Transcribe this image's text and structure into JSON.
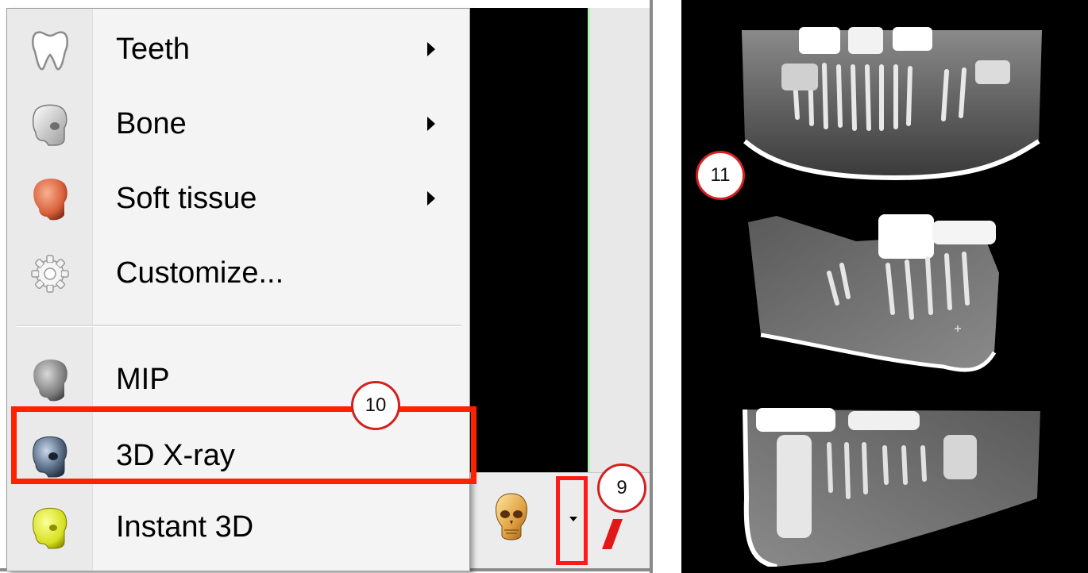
{
  "menu": {
    "items": [
      {
        "label": "Teeth",
        "icon": "tooth-icon",
        "has_submenu": true
      },
      {
        "label": "Bone",
        "icon": "skull-bone-icon",
        "has_submenu": true
      },
      {
        "label": "Soft tissue",
        "icon": "head-soft-tissue-icon",
        "has_submenu": true
      },
      {
        "label": "Customize...",
        "icon": "gear-icon",
        "has_submenu": false
      },
      {
        "label": "MIP",
        "icon": "head-mip-icon",
        "has_submenu": false
      },
      {
        "label": "3D X-ray",
        "icon": "skull-xray-icon",
        "has_submenu": false,
        "highlighted": true
      },
      {
        "label": "Instant 3D",
        "icon": "skull-instant3d-icon",
        "has_submenu": false
      }
    ]
  },
  "toolbar": {
    "render_mode_icon": "skull-render-icon",
    "dropdown_icon": "dropdown-caret-icon"
  },
  "callouts": {
    "dropdown": "9",
    "menu_item": "10",
    "xray_views": "11"
  },
  "colors": {
    "highlight": "#ff2200",
    "callout_border": "#d42020",
    "viewport_accent": "#b6f0b6"
  }
}
